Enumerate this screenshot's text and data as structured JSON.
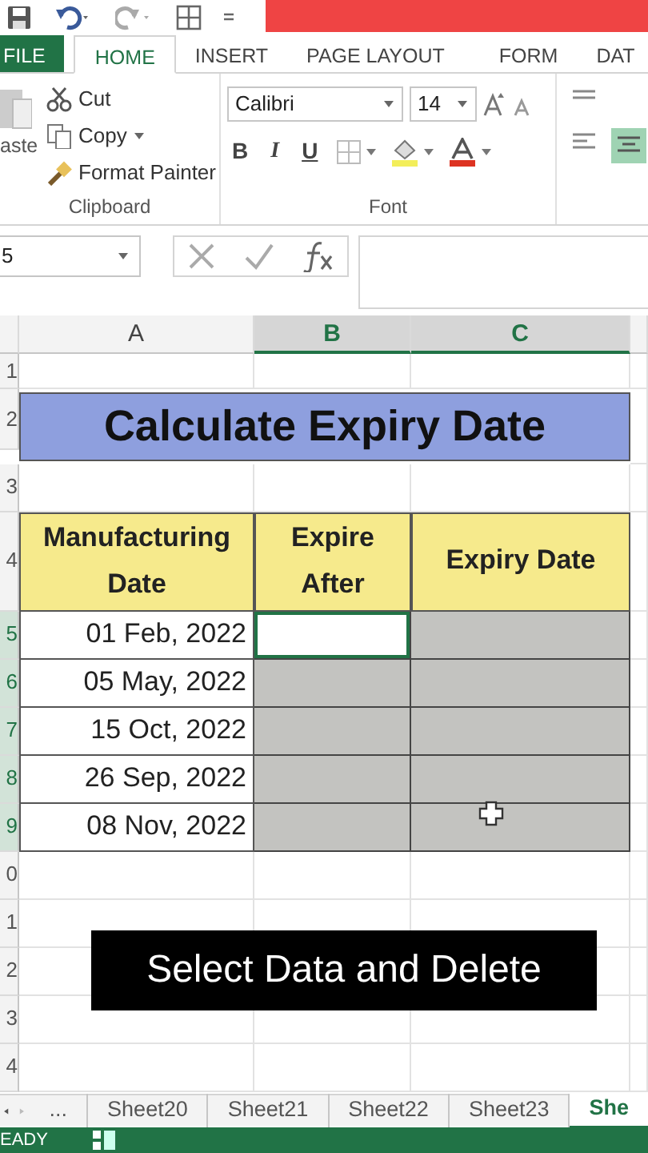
{
  "ribbon_tabs": [
    {
      "label": "FILE",
      "kind": "file",
      "selected": false
    },
    {
      "label": "HOME",
      "kind": "tab",
      "selected": true
    },
    {
      "label": "INSERT",
      "kind": "tab",
      "selected": false
    },
    {
      "label": "PAGE LAYOUT",
      "kind": "tab",
      "selected": false
    },
    {
      "label": "FORM",
      "kind": "tab",
      "selected": false
    },
    {
      "label": "DAT",
      "kind": "tab",
      "selected": false
    }
  ],
  "clipboard": {
    "paste_label": "aste",
    "buttons": [
      "Cut",
      "Copy",
      "Format Painter"
    ],
    "group_label": "Clipboard"
  },
  "font": {
    "font_name": "Calibri",
    "font_size": "14",
    "bold": "B",
    "italic": "I",
    "underline": "U",
    "group_label": "Font"
  },
  "name_box": "5",
  "columns": [
    {
      "label": "A",
      "selected": false
    },
    {
      "label": "B",
      "selected": true
    },
    {
      "label": "C",
      "selected": true
    }
  ],
  "rows": [
    {
      "number": "1",
      "selected": false,
      "kind": "blank"
    },
    {
      "number": "2",
      "selected": false,
      "kind": "title",
      "text": "Calculate Expiry Date"
    },
    {
      "number": "3",
      "selected": false,
      "kind": "blank"
    },
    {
      "number": "4",
      "selected": false,
      "kind": "header",
      "cells": [
        {
          "text": "Manufacturing Date"
        },
        {
          "text": "Expire After"
        },
        {
          "text": "Expiry Date"
        }
      ]
    },
    {
      "number": "5",
      "selected": true,
      "kind": "data",
      "cells": [
        {
          "text": "01 Feb, 2022"
        },
        {
          "selected": true,
          "active": true
        },
        {
          "selected": true,
          "active": false
        }
      ]
    },
    {
      "number": "6",
      "selected": true,
      "kind": "data",
      "cells": [
        {
          "text": "05 May, 2022"
        },
        {
          "selected": true,
          "active": false
        },
        {
          "selected": true,
          "active": false
        }
      ]
    },
    {
      "number": "7",
      "selected": true,
      "kind": "data",
      "cells": [
        {
          "text": "15 Oct, 2022"
        },
        {
          "selected": true,
          "active": false
        },
        {
          "selected": true,
          "active": false
        }
      ]
    },
    {
      "number": "8",
      "selected": true,
      "kind": "data",
      "cells": [
        {
          "text": "26 Sep, 2022"
        },
        {
          "selected": true,
          "active": false
        },
        {
          "selected": true,
          "active": false
        }
      ]
    },
    {
      "number": "9",
      "selected": true,
      "kind": "data",
      "cells": [
        {
          "text": "08 Nov, 2022"
        },
        {
          "selected": true,
          "active": false
        },
        {
          "selected": true,
          "active": false
        }
      ]
    },
    {
      "number": "0",
      "selected": false,
      "kind": "blank"
    },
    {
      "number": "1",
      "selected": false,
      "kind": "blank"
    },
    {
      "number": "2",
      "selected": false,
      "kind": "blank"
    },
    {
      "number": "3",
      "selected": false,
      "kind": "blank"
    },
    {
      "number": "4",
      "selected": false,
      "kind": "blank"
    }
  ],
  "caption": "Select Data and Delete",
  "sheet_nav": "...",
  "sheet_tabs": [
    {
      "label": "Sheet20",
      "selected": false
    },
    {
      "label": "Sheet21",
      "selected": false
    },
    {
      "label": "Sheet22",
      "selected": false
    },
    {
      "label": "Sheet23",
      "selected": false
    },
    {
      "label": "She",
      "selected": true
    }
  ],
  "status": "EADY"
}
